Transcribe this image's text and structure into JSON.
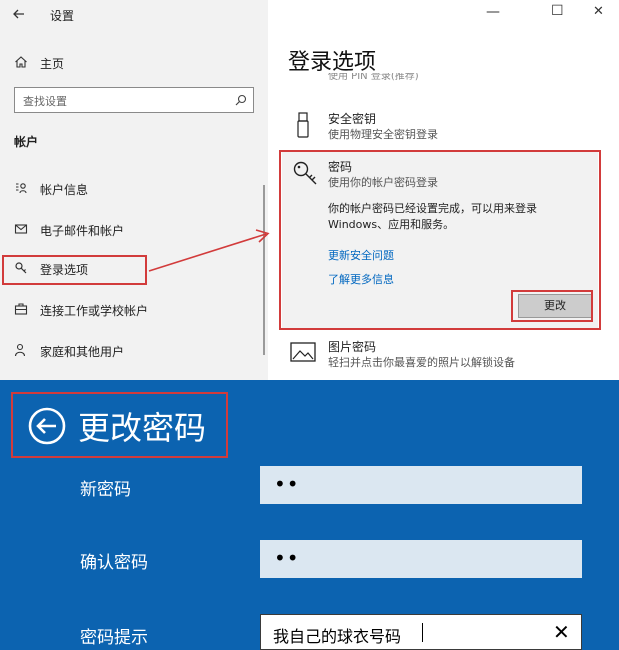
{
  "window": {
    "title": "设置",
    "controls": {
      "minimize": "—",
      "maximize": "☐",
      "close": "✕"
    }
  },
  "sidebar": {
    "home": "主页",
    "search_placeholder": "查找设置",
    "section": "帐户",
    "items": [
      {
        "label": "帐户信息",
        "icon": "account-info-icon"
      },
      {
        "label": "电子邮件和帐户",
        "icon": "mail-icon"
      },
      {
        "label": "登录选项",
        "icon": "key-icon"
      },
      {
        "label": "连接工作或学校帐户",
        "icon": "briefcase-icon"
      },
      {
        "label": "家庭和其他用户",
        "icon": "person-icon"
      }
    ]
  },
  "main": {
    "title": "登录选项",
    "clipped_text": "使用 PIN 登录(推荐)",
    "security_key": {
      "title": "安全密钥",
      "desc": "使用物理安全密钥登录"
    },
    "password": {
      "title": "密码",
      "desc": "使用你的帐户密码登录",
      "info_line1": "你的帐户密码已经设置完成，可以用来登录",
      "info_line2": "Windows、应用和服务。",
      "link1": "更新安全问题",
      "link2": "了解更多信息",
      "change_button": "更改"
    },
    "picture_password": {
      "title": "图片密码",
      "desc": "轻扫并点击你最喜爱的照片以解锁设备"
    }
  },
  "change_password": {
    "title": "更改密码",
    "new_password_label": "新密码",
    "new_password_value": "••",
    "confirm_label": "确认密码",
    "confirm_value": "••",
    "hint_label": "密码提示",
    "hint_value": "我自己的球衣号码",
    "clear": "✕"
  },
  "colors": {
    "blue": "#0c63b0",
    "red": "#d23b3b",
    "link": "#0067c0",
    "input": "#dbe7f1"
  }
}
